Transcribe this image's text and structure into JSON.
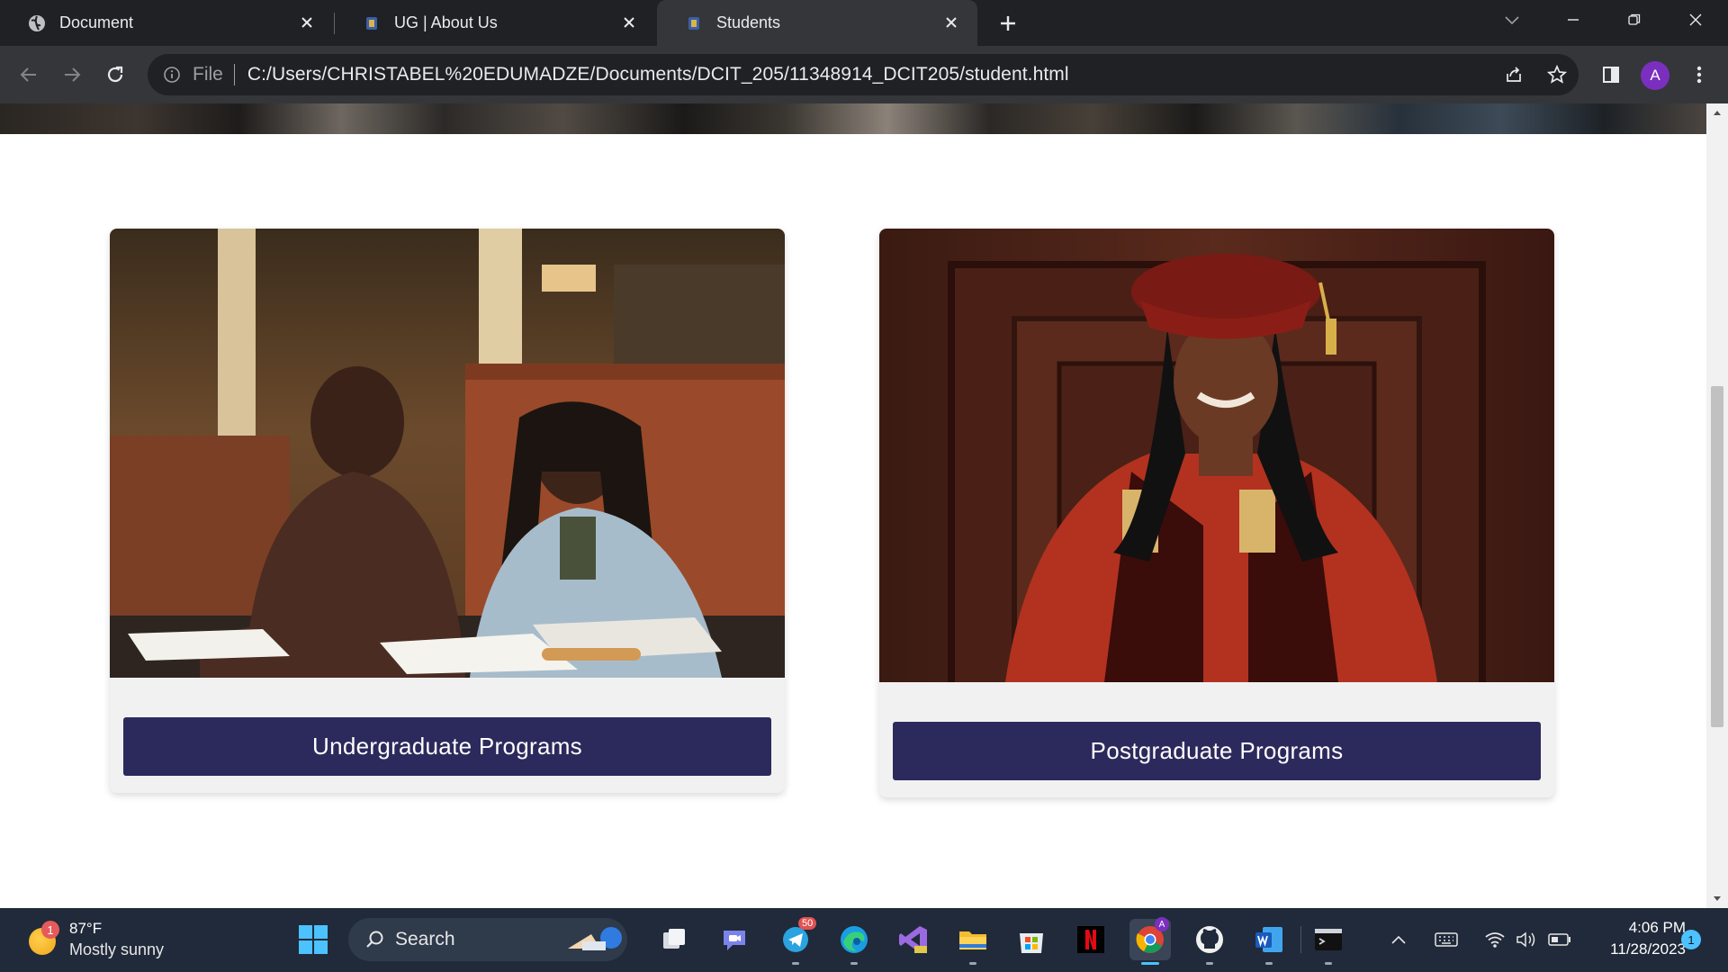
{
  "browser": {
    "tabs": [
      {
        "title": "Document",
        "active": false
      },
      {
        "title": "UG | About Us",
        "active": false
      },
      {
        "title": "Students",
        "active": true
      }
    ],
    "omnibox": {
      "scheme_label": "File",
      "url": "C:/Users/CHRISTABEL%20EDUMADZE/Documents/DCIT_205/11348914_DCIT205/student.html"
    },
    "profile_initial": "A"
  },
  "page": {
    "cards": [
      {
        "button_label": "Undergraduate Programs",
        "image": "students-studying-photo"
      },
      {
        "button_label": "Postgraduate Programs",
        "image": "graduate-in-gown-photo"
      }
    ],
    "button_color": "#2c2a5c"
  },
  "taskbar": {
    "weather": {
      "temp": "87°F",
      "condition": "Mostly sunny",
      "badge": "1"
    },
    "search_label": "Search",
    "telegram_badge": "50",
    "time": "4:06 PM",
    "date": "11/28/2023",
    "notification_count": "1"
  }
}
